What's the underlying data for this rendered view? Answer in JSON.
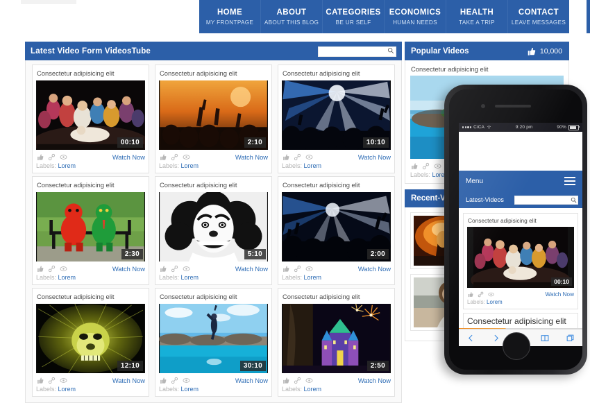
{
  "nav": {
    "items": [
      {
        "title": "HOME",
        "sub": "MY FRONTPAGE"
      },
      {
        "title": "ABOUT",
        "sub": "ABOUT THIS BLOG"
      },
      {
        "title": "CATEGORIES",
        "sub": "BE UR SELF"
      },
      {
        "title": "ECONOMICS",
        "sub": "HUMAN NEEDS"
      },
      {
        "title": "HEALTH",
        "sub": "TAKE A TRIP"
      },
      {
        "title": "CONTACT",
        "sub": "LEAVE MESSAGES"
      }
    ]
  },
  "main": {
    "header_title": "Latest Video Form VideosTube",
    "search": {
      "value": "",
      "placeholder": ""
    },
    "watch_label": "Watch Now",
    "labels_prefix": "Labels: ",
    "labels_value": "Lorem",
    "cards": [
      {
        "title": "Consectetur adipisicing elit",
        "duration": "00:10",
        "image": "theatre-crowd"
      },
      {
        "title": "Consectetur adipisicing elit",
        "duration": "2:10",
        "image": "concert-hands"
      },
      {
        "title": "Consectetur adipisicing elit",
        "duration": "10:10",
        "image": "stage-lights"
      },
      {
        "title": "Consectetur adipisicing elit",
        "duration": "2:30",
        "image": "mascots-bench"
      },
      {
        "title": "Consectetur adipisicing elit",
        "duration": "5:10",
        "image": "clown-face"
      },
      {
        "title": "Consectetur adipisicing elit",
        "duration": "2:00",
        "image": "concert-silhouette"
      },
      {
        "title": "Consectetur adipisicing elit",
        "duration": "12:10",
        "image": "lion-art"
      },
      {
        "title": "Consectetur adipisicing elit",
        "duration": "30:10",
        "image": "diver-pool"
      },
      {
        "title": "Consectetur adipisicing elit",
        "duration": "2:50",
        "image": "castle-fireworks"
      }
    ]
  },
  "sidebar": {
    "popular_title": "Popular Videos",
    "likes_count": "10,000",
    "popular_card": {
      "title": "Consectetur adipisicing elit",
      "image": "beach-rocks"
    },
    "recent_title": "Recent-Videos",
    "recent_items": [
      {
        "image": "guitar-concert"
      },
      {
        "image": "girl-portrait"
      }
    ]
  },
  "phone": {
    "status": {
      "carrier": "CiCA",
      "time": "9:20 pm",
      "battery": "90%"
    },
    "menu_label": "Menu",
    "search_label": "Latest-Videos",
    "search": {
      "value": "",
      "placeholder": ""
    },
    "card": {
      "title": "Consectetur adipisicing elit",
      "duration": "00:10",
      "image": "theatre-crowd"
    },
    "card2_title": "Consectetur adipisicing elit",
    "watch_label": "Watch Now",
    "labels_prefix": "Labels: ",
    "labels_value": "Lorem"
  },
  "colors": {
    "brand_blue": "#2c5fa8",
    "link_blue": "#2d6cb5",
    "muted": "#b3b3b3"
  }
}
